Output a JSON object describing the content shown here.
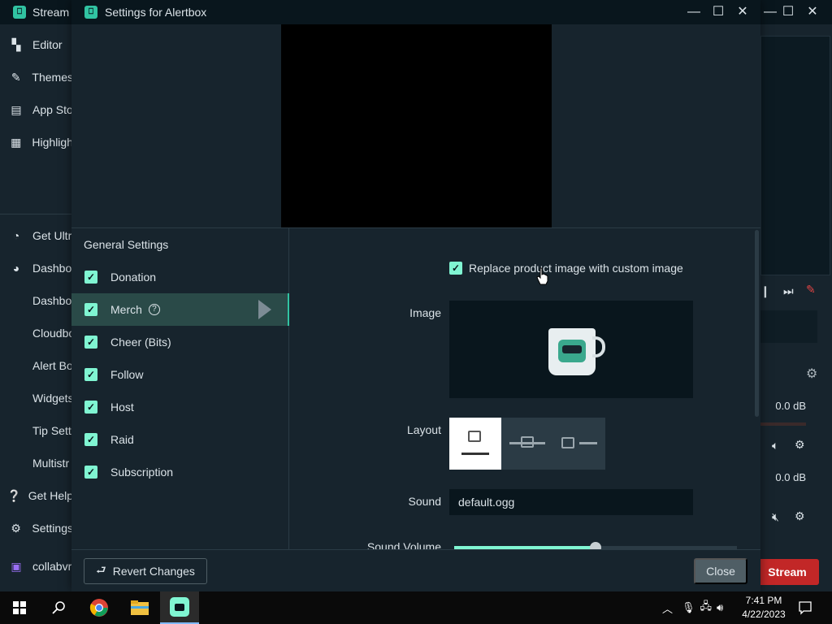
{
  "app": {
    "title": "Stream",
    "sidebar": [
      {
        "icon": "editor-icon",
        "label": "Editor"
      },
      {
        "icon": "themes-icon",
        "label": "Themes"
      },
      {
        "icon": "app-store-icon",
        "label": "App Sto"
      },
      {
        "icon": "highlighter-icon",
        "label": "Highligh"
      },
      {
        "icon": "ultra-icon",
        "label": "Get Ultr"
      },
      {
        "icon": "dashboard-icon",
        "label": "Dashbo"
      },
      {
        "label": "Dashbo"
      },
      {
        "label": "Cloudbo"
      },
      {
        "label": "Alert Bo"
      },
      {
        "label": "Widgets"
      },
      {
        "label": "Tip Sett"
      },
      {
        "label": "Multistr"
      },
      {
        "icon": "help-icon",
        "label": "Get Help"
      },
      {
        "icon": "settings-icon",
        "label": "Settings"
      },
      {
        "icon": "twitch-icon",
        "label": "collabvr"
      }
    ],
    "right": {
      "db1": "0.0 dB",
      "db2": "0.0 dB",
      "stream_button": "Stream"
    }
  },
  "modal": {
    "title": "Settings for Alertbox",
    "nav_heading": "General Settings",
    "nav_items": [
      {
        "label": "Donation",
        "checked": true
      },
      {
        "label": "Merch",
        "checked": true,
        "active": true
      },
      {
        "label": "Cheer (Bits)",
        "checked": true
      },
      {
        "label": "Follow",
        "checked": true
      },
      {
        "label": "Host",
        "checked": true
      },
      {
        "label": "Raid",
        "checked": true
      },
      {
        "label": "Subscription",
        "checked": true
      }
    ],
    "form": {
      "replace_image_label": "Replace product image with custom image",
      "image_label": "Image",
      "layout_label": "Layout",
      "sound_label": "Sound",
      "sound_value": "default.ogg",
      "sound_volume_label": "Sound Volume",
      "sound_volume_fraction": 0.5
    },
    "footer": {
      "revert_label": "Revert Changes",
      "close_label": "Close"
    }
  },
  "taskbar": {
    "time": "7:41 PM",
    "date": "4/22/2023"
  },
  "colors": {
    "accent": "#80f5d2",
    "background": "#17242d",
    "titlebar": "#09161d"
  }
}
